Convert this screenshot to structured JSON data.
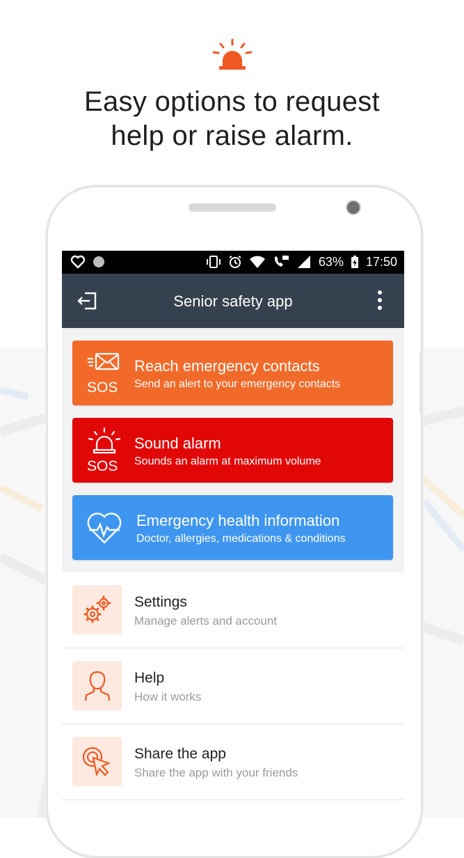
{
  "promo": {
    "icon": "siren-icon",
    "headline_line1": "Easy options to request",
    "headline_line2": "help or raise alarm."
  },
  "statusbar": {
    "battery": "63%",
    "time": "17:50",
    "icons": [
      "heart-icon",
      "circle-icon",
      "vibrate-icon",
      "alarm-clock-icon",
      "wifi-icon",
      "volte-call-icon",
      "signal-icon",
      "battery-charging-icon"
    ]
  },
  "appbar": {
    "title": "Senior safety app",
    "back_icon": "exit-icon",
    "menu_icon": "more-vert-icon"
  },
  "actions": [
    {
      "title": "Reach emergency contacts",
      "subtitle": "Send an alert to your emergency contacts",
      "badge": "SOS",
      "icon": "message-alert-icon",
      "color": "#f26a2a"
    },
    {
      "title": "Sound alarm",
      "subtitle": "Sounds an alarm at maximum volume",
      "badge": "SOS",
      "icon": "siren-icon",
      "color": "#e20707"
    },
    {
      "title": "Emergency health information",
      "subtitle": "Doctor, allergies, medications & conditions",
      "icon": "heart-pulse-icon",
      "color": "#3f96f0"
    }
  ],
  "menu": [
    {
      "title": "Settings",
      "subtitle": "Manage alerts and account",
      "icon": "gears-icon"
    },
    {
      "title": "Help",
      "subtitle": "How it works",
      "icon": "person-icon"
    },
    {
      "title": "Share the app",
      "subtitle": "Share the app with your friends",
      "icon": "tap-pointer-icon"
    }
  ],
  "colors": {
    "accent": "#ee5a22",
    "appbar": "#36414f",
    "tile_bg": "#fde9df"
  }
}
